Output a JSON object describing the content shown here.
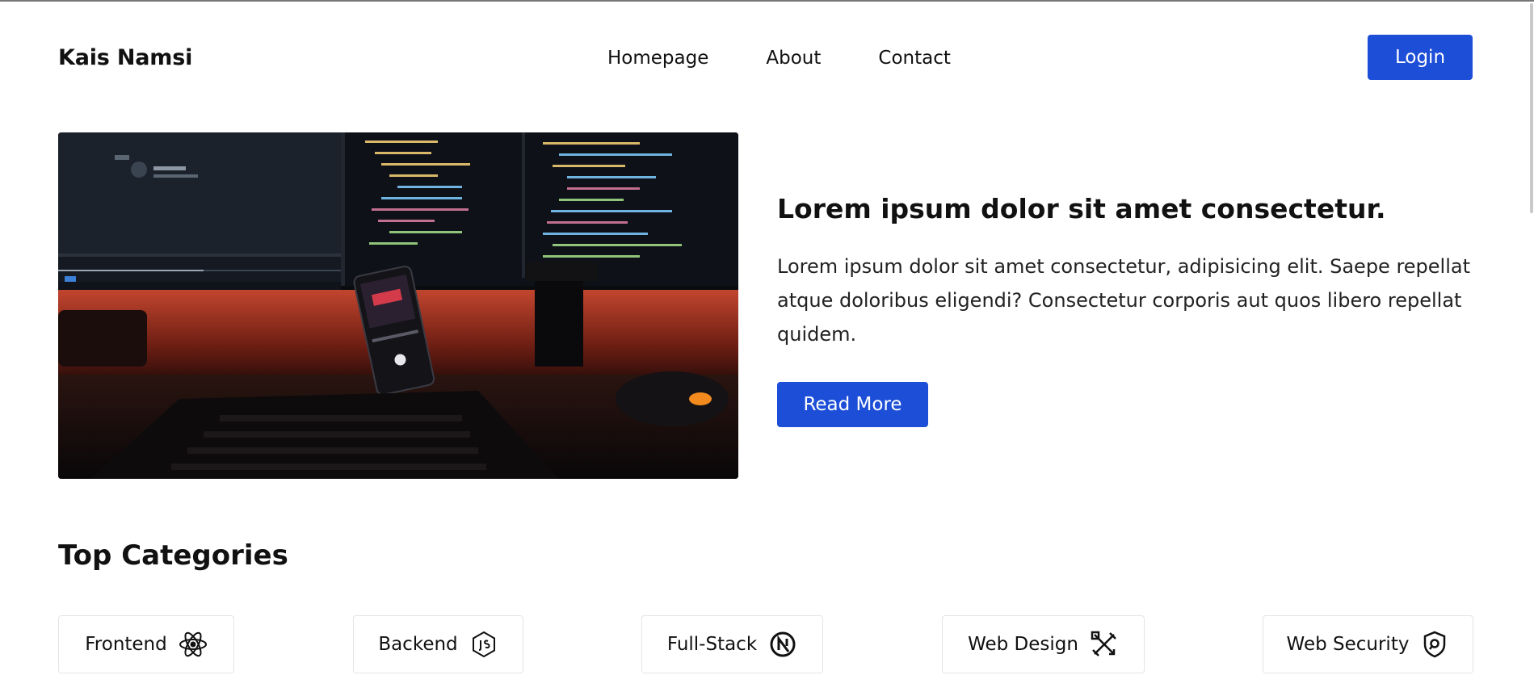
{
  "header": {
    "brand": "Kais Namsi",
    "nav": [
      "Homepage",
      "About",
      "Contact"
    ],
    "login_label": "Login"
  },
  "hero": {
    "image": "desk-setup-code-monitors-phone-keyboard",
    "title": "Lorem ipsum dolor sit amet consectetur.",
    "body": "Lorem ipsum dolor sit amet consectetur, adipisicing elit. Saepe repellat atque doloribus eligendi? Consectetur corporis aut quos libero repellat quidem.",
    "read_more_label": "Read More"
  },
  "categories": {
    "title": "Top Categories",
    "items": [
      {
        "label": "Frontend",
        "icon": "react-icon"
      },
      {
        "label": "Backend",
        "icon": "nodejs-icon"
      },
      {
        "label": "Full-Stack",
        "icon": "nextjs-icon"
      },
      {
        "label": "Web Design",
        "icon": "design-tools-icon"
      },
      {
        "label": "Web Security",
        "icon": "shield-search-icon"
      }
    ]
  },
  "colors": {
    "accent": "#1d4ed8",
    "text": "#111111",
    "card_border": "#e4e4e4"
  }
}
